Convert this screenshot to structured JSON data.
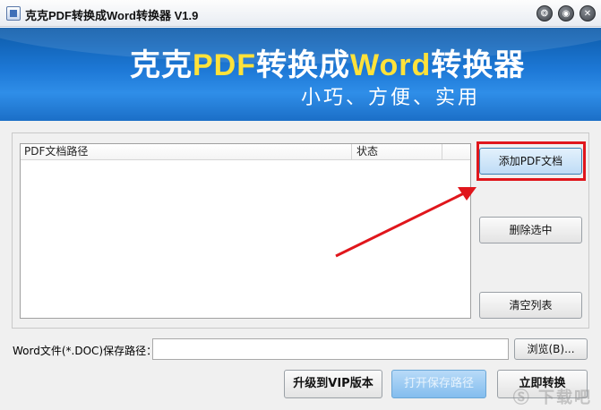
{
  "window": {
    "title": "克克PDF转换成Word转换器 V1.9",
    "controls": [
      "❂",
      "◉",
      "✕"
    ]
  },
  "banner": {
    "title_part1": "克克",
    "title_part2": "PDF",
    "title_part3": "转换成",
    "title_part4": "Word",
    "title_part5": "转换器",
    "subtitle": "小巧、方便、实用"
  },
  "file_list": {
    "columns": [
      "PDF文档路径",
      "状态"
    ]
  },
  "side_buttons": {
    "add": "添加PDF文档",
    "remove": "删除选中",
    "clear": "清空列表"
  },
  "save_path": {
    "label": "Word文件(*.DOC)保存路径：",
    "value": "",
    "browse": "浏览(B)..."
  },
  "bottom_buttons": {
    "vip": "升级到VIP版本",
    "open": "打开保存路径",
    "convert": "立即转换"
  },
  "watermark": "Ⓢ 下载吧",
  "colors": {
    "banner": "#1d78d6",
    "highlight": "#e0161c",
    "accent_yellow": "#ffe23a"
  }
}
